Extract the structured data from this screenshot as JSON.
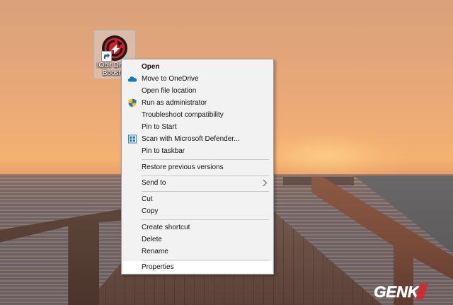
{
  "desktop_icon": {
    "label": "IObit Driver Booster"
  },
  "context_menu": {
    "items": [
      {
        "label": "Open",
        "bold": true,
        "icon": ""
      },
      {
        "label": "Move to OneDrive",
        "icon": "onedrive-cloud-icon"
      },
      {
        "label": "Open file location",
        "icon": ""
      },
      {
        "label": "Run as administrator",
        "icon": "uac-shield-icon"
      },
      {
        "label": "Troubleshoot compatibility",
        "icon": ""
      },
      {
        "label": "Pin to Start",
        "icon": ""
      },
      {
        "label": "Scan with Microsoft Defender...",
        "icon": "defender-icon"
      },
      {
        "label": "Pin to taskbar",
        "icon": ""
      },
      {
        "label": "Restore previous versions",
        "icon": ""
      },
      {
        "label": "Send to",
        "icon": "",
        "submenu": true
      },
      {
        "label": "Cut",
        "icon": ""
      },
      {
        "label": "Copy",
        "icon": ""
      },
      {
        "label": "Create shortcut",
        "icon": ""
      },
      {
        "label": "Delete",
        "icon": ""
      },
      {
        "label": "Rename",
        "icon": ""
      },
      {
        "label": "Properties",
        "icon": ""
      }
    ]
  },
  "watermark": {
    "brand": "GENK",
    "brand_color": "#d9252a"
  },
  "colors": {
    "menu_bg": "#f2f2f2",
    "onedrive": "#0f78d4",
    "shield_blue": "#2a6fd6",
    "shield_yellow": "#f5c400",
    "logo_red": "#d01f26"
  }
}
